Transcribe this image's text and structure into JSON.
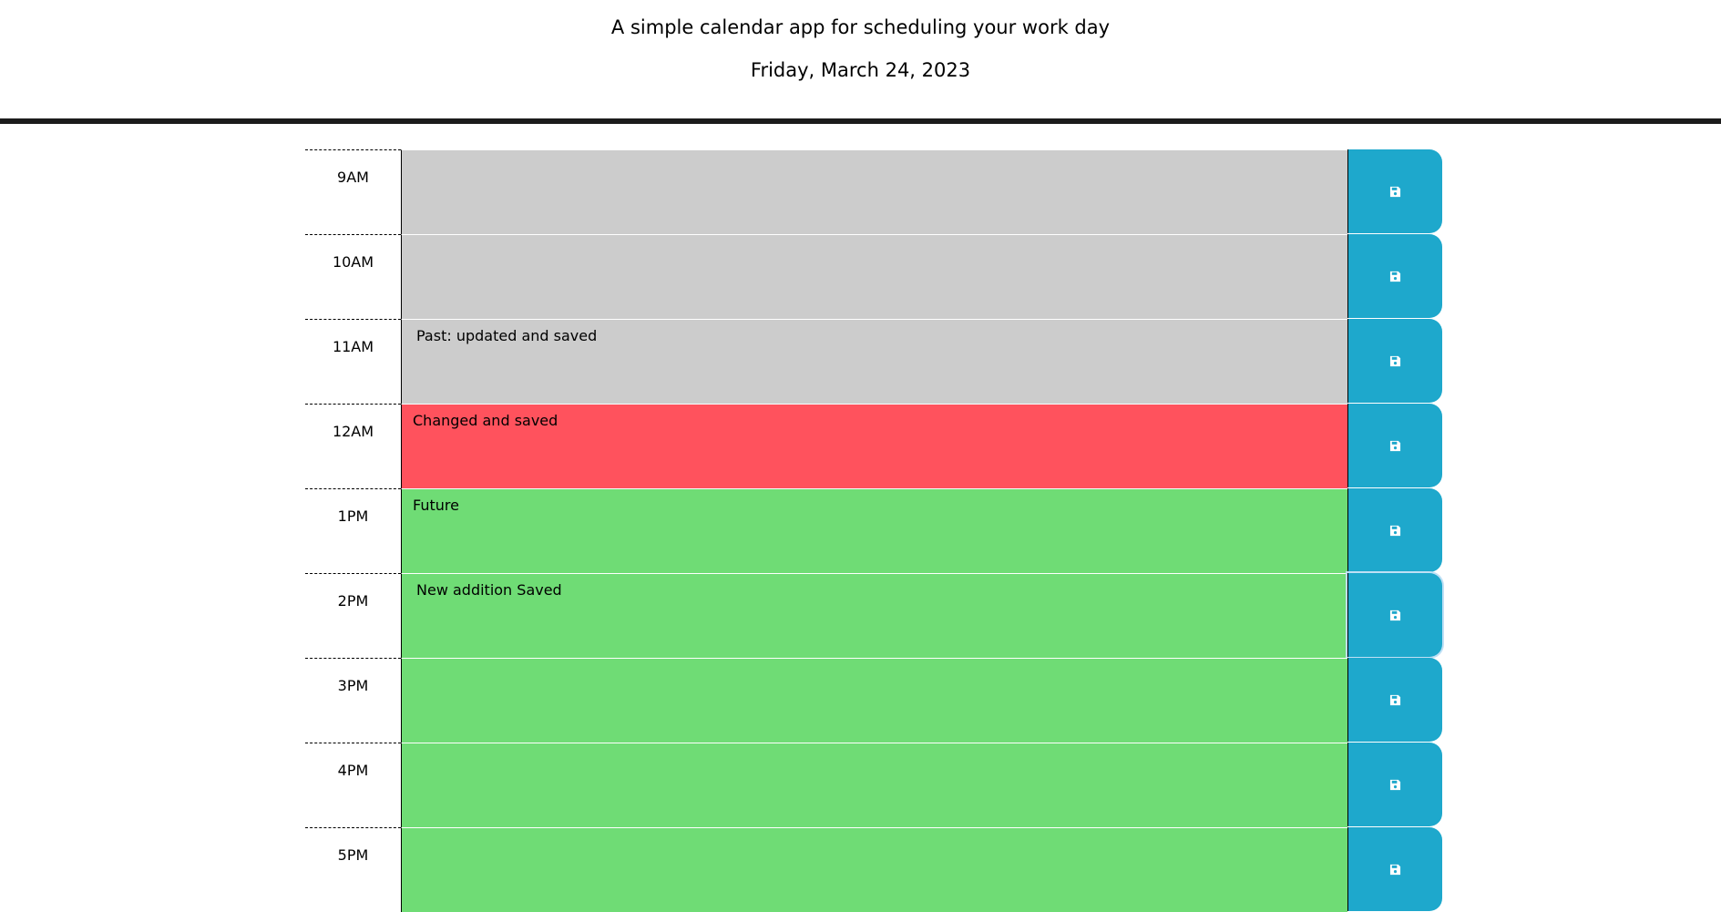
{
  "header": {
    "subtitle": "A simple calendar app for scheduling your work day",
    "current_day": "Friday, March 24, 2023"
  },
  "colors": {
    "past": "#cccccc",
    "present": "#ff525d",
    "future": "#6fdc75",
    "save_button": "#1ea8cc"
  },
  "timeblocks": [
    {
      "hour": "9AM",
      "text": "",
      "state": "past",
      "save_icon": "floppy-disk-icon"
    },
    {
      "hour": "10AM",
      "text": "",
      "state": "past",
      "save_icon": "floppy-disk-icon"
    },
    {
      "hour": "11AM",
      "text": "Past: updated and saved",
      "state": "past",
      "save_icon": "floppy-disk-icon"
    },
    {
      "hour": "12AM",
      "text": "Changed and saved",
      "state": "present",
      "save_icon": "floppy-disk-icon"
    },
    {
      "hour": "1PM",
      "text": "Future",
      "state": "future",
      "save_icon": "floppy-disk-icon"
    },
    {
      "hour": "2PM",
      "text": "New addition Saved",
      "state": "future",
      "save_icon": "floppy-disk-icon"
    },
    {
      "hour": "3PM",
      "text": "",
      "state": "future",
      "save_icon": "floppy-disk-icon"
    },
    {
      "hour": "4PM",
      "text": "",
      "state": "future",
      "save_icon": "floppy-disk-icon"
    },
    {
      "hour": "5PM",
      "text": "",
      "state": "future",
      "save_icon": "floppy-disk-icon"
    }
  ]
}
